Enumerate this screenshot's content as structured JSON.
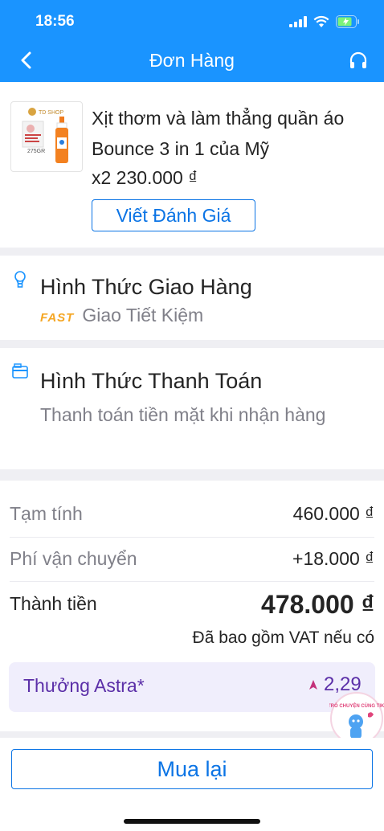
{
  "status_bar": {
    "time": "18:56"
  },
  "header": {
    "title": "Đơn Hàng"
  },
  "product": {
    "thumb_brand": "TD SHOP",
    "thumb_weight": "275GR",
    "name": "Xịt thơm và làm thẳng quần áo Bounce 3 in 1 của Mỹ",
    "quantity_price": "x2 230.000 ₫",
    "review_button": "Viết Đánh Giá"
  },
  "shipping": {
    "title": "Hình Thức Giao Hàng",
    "badge": "FAST",
    "method": "Giao Tiết Kiệm"
  },
  "payment": {
    "title": "Hình Thức Thanh Toán",
    "method": "Thanh toán tiền mặt khi nhận hàng"
  },
  "summary": {
    "subtotal_label": "Tạm tính",
    "subtotal_value": "460.000 ₫",
    "shipping_label": "Phí vận chuyển",
    "shipping_value": "+18.000 ₫",
    "total_label": "Thành tiền",
    "total_value": "478.000 ₫",
    "vat_note": "Đã bao gồm VAT nếu có"
  },
  "astra": {
    "label": "Thưởng Astra*",
    "value": "2,29"
  },
  "chat_bubble": {
    "text": "TRÒ CHUYỆN CÙNG TIKI"
  },
  "actions": {
    "rebuy_button": "Mua lại"
  },
  "colors": {
    "header_blue": "#1a94ff",
    "link_blue": "#0b74e5",
    "astra_purple": "#5b2fa8",
    "fast_orange": "#f5a623"
  }
}
